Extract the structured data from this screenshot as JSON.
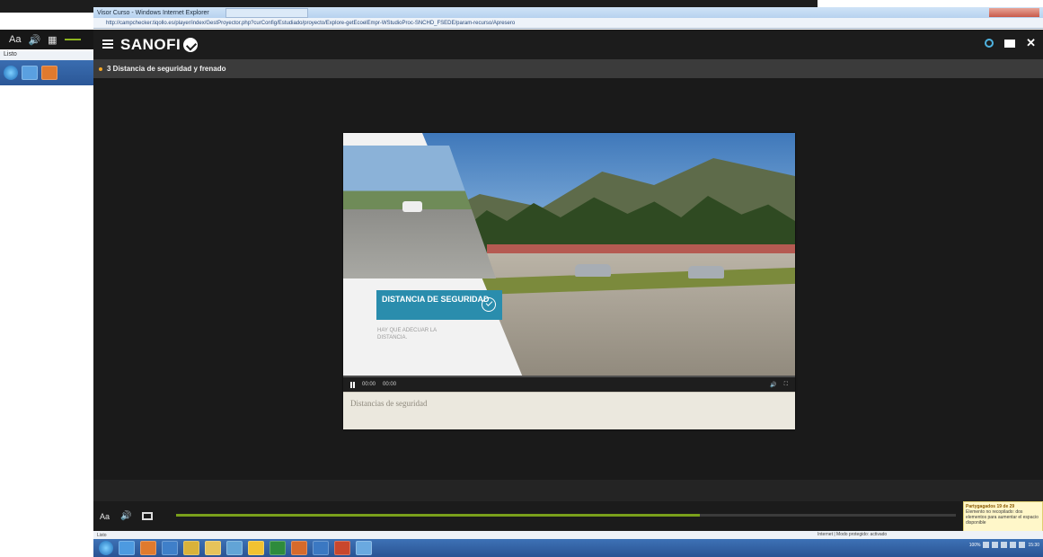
{
  "bg_window": {
    "font_size_label": "Aa",
    "status_text": "Listo"
  },
  "browser": {
    "title": "Visor Curso - Windows Internet Explorer",
    "address": "http://campchecker.tiqollo.es/player/index/GestProyector.php?curConfig/Estudiado/proyecto/Explore-getEcoelEmpr-WStudioProc-SNCHD_FSEDE/param-recurso/Apresero"
  },
  "app": {
    "logo_text": "SANOFI",
    "section_title": "3 Distancia de seguridad y frenado",
    "video": {
      "label_title": "DISTANCIA DE SEGURIDAD",
      "label_sub": "HAY QUE ADECUAR LA DISTANCIA.",
      "time_current": "00:00",
      "time_total": "00:00",
      "caption": "Distancias de seguridad"
    },
    "player": {
      "font_size_label": "Aa",
      "progress": 0.672
    }
  },
  "notification": {
    "title": "Partygagados 19 de 29",
    "body": "Elemento no recopilado: dos elementos para aumentar el espacio disponible"
  },
  "statusbar": {
    "left": "Listo",
    "zone": "Internet | Modo protegido: activado"
  },
  "taskbar": {
    "zoom": "100%",
    "clock": "15:30"
  },
  "colors": {
    "accent_green": "#7aa01b",
    "label_blue": "#2a8dad",
    "orange_dot": "#f5a623"
  }
}
